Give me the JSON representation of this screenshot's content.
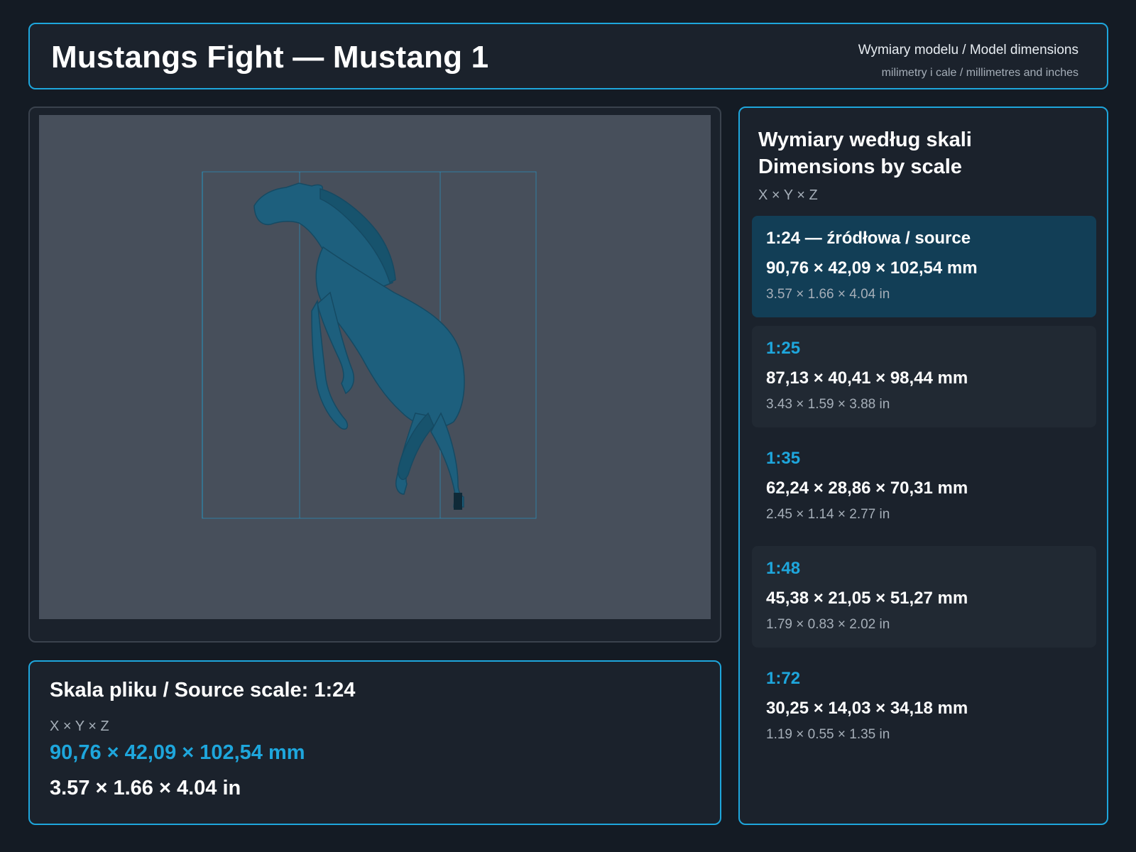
{
  "header": {
    "title": "Mustangs Fight — Mustang 1",
    "subtitle": "Wymiary modelu / Model dimensions",
    "units_note": "milimetry i cale / millimetres and inches"
  },
  "viewer": {
    "subject": "mustang-model-render",
    "model_color": "#1d5f7d",
    "guide_color": "#1ea6dc"
  },
  "source": {
    "title": "Skala pliku / Source scale: 1:24",
    "axes": "X × Y × Z",
    "mm": "90,76 × 42,09 × 102,54 mm",
    "inches": "3.57 × 1.66 × 4.04 in"
  },
  "scales_panel": {
    "title_line1": "Wymiary według skali",
    "title_line2": "Dimensions by scale",
    "axes": "X × Y × Z",
    "items": [
      {
        "label": "1:24  —  źródłowa / source",
        "mm": "90,76 × 42,09 × 102,54 mm",
        "inches": "3.57 × 1.66 × 4.04 in"
      },
      {
        "label": "1:25",
        "mm": "87,13 × 40,41 × 98,44 mm",
        "inches": "3.43 × 1.59 × 3.88 in"
      },
      {
        "label": "1:35",
        "mm": "62,24 × 28,86 × 70,31 mm",
        "inches": "2.45 × 1.14 × 2.77 in"
      },
      {
        "label": "1:48",
        "mm": "45,38 × 21,05 × 51,27 mm",
        "inches": "1.79 × 0.83 × 2.02 in"
      },
      {
        "label": "1:72",
        "mm": "30,25 × 14,03 × 34,18 mm",
        "inches": "1.19 × 0.55 × 1.35 in"
      }
    ]
  },
  "colors": {
    "accent": "#1ea6dc",
    "background": "#141b24",
    "panel": "#1b222c",
    "active_card": "#123e56"
  }
}
